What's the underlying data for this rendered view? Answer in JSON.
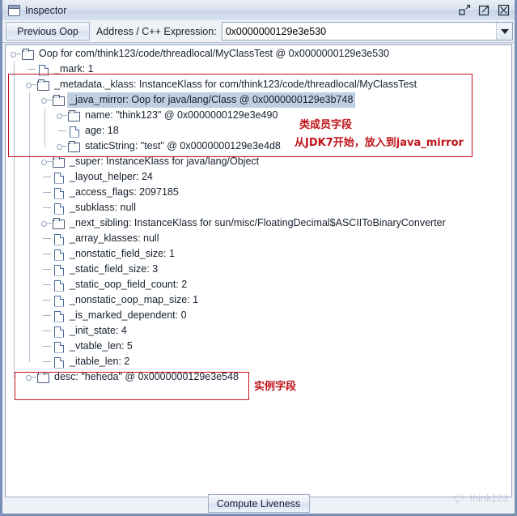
{
  "window": {
    "title": "Inspector",
    "icon": "window-icon",
    "buttons": [
      {
        "name": "minimize-button",
        "label": "Minimize"
      },
      {
        "name": "maximize-button",
        "label": "Maximize"
      },
      {
        "name": "close-button",
        "label": "Close"
      }
    ]
  },
  "toolbar": {
    "previous_oop_label": "Previous Oop",
    "address_label": "Address / C++ Expression:",
    "address_value": "0x0000000129e3e530",
    "address_placeholder": "",
    "dropdown_icon": "chevron-down-icon"
  },
  "tree": {
    "rows": [
      {
        "depth": 0,
        "icon": "folder",
        "handle": "expanded",
        "label": "Oop for com/think123/code/threadlocal/MyClassTest @ 0x0000000129e3e530",
        "selected": false
      },
      {
        "depth": 1,
        "icon": "doc",
        "handle": "leaf",
        "label": "_mark: 1",
        "selected": false
      },
      {
        "depth": 1,
        "icon": "folder",
        "handle": "expanded",
        "label": "_metadata._klass: InstanceKlass for com/think123/code/threadlocal/MyClassTest",
        "selected": false
      },
      {
        "depth": 2,
        "icon": "folder",
        "handle": "expanded",
        "label": "_java_mirror: Oop for java/lang/Class @ 0x0000000129e3b748",
        "selected": true
      },
      {
        "depth": 3,
        "icon": "folder",
        "handle": "collapsed",
        "label": "name: \"think123\" @ 0x0000000129e3e490",
        "selected": false
      },
      {
        "depth": 3,
        "icon": "doc",
        "handle": "leaf",
        "label": "age: 18",
        "selected": false
      },
      {
        "depth": 3,
        "icon": "folder",
        "handle": "collapsed",
        "label": "staticString: \"test\" @ 0x0000000129e3e4d8",
        "selected": false
      },
      {
        "depth": 2,
        "icon": "folder",
        "handle": "collapsed",
        "label": "_super: InstanceKlass for java/lang/Object",
        "selected": false
      },
      {
        "depth": 2,
        "icon": "doc",
        "handle": "leaf",
        "label": "_layout_helper: 24",
        "selected": false
      },
      {
        "depth": 2,
        "icon": "doc",
        "handle": "leaf",
        "label": "_access_flags: 2097185",
        "selected": false
      },
      {
        "depth": 2,
        "icon": "doc",
        "handle": "leaf",
        "label": "_subklass: null",
        "selected": false
      },
      {
        "depth": 2,
        "icon": "folder",
        "handle": "collapsed",
        "label": "_next_sibling: InstanceKlass for sun/misc/FloatingDecimal$ASCIIToBinaryConverter",
        "selected": false
      },
      {
        "depth": 2,
        "icon": "doc",
        "handle": "leaf",
        "label": "_array_klasses: null",
        "selected": false
      },
      {
        "depth": 2,
        "icon": "doc",
        "handle": "leaf",
        "label": "_nonstatic_field_size: 1",
        "selected": false
      },
      {
        "depth": 2,
        "icon": "doc",
        "handle": "leaf",
        "label": "_static_field_size: 3",
        "selected": false
      },
      {
        "depth": 2,
        "icon": "doc",
        "handle": "leaf",
        "label": "_static_oop_field_count: 2",
        "selected": false
      },
      {
        "depth": 2,
        "icon": "doc",
        "handle": "leaf",
        "label": "_nonstatic_oop_map_size: 1",
        "selected": false
      },
      {
        "depth": 2,
        "icon": "doc",
        "handle": "leaf",
        "label": "_is_marked_dependent: 0",
        "selected": false
      },
      {
        "depth": 2,
        "icon": "doc",
        "handle": "leaf",
        "label": "_init_state: 4",
        "selected": false
      },
      {
        "depth": 2,
        "icon": "doc",
        "handle": "leaf",
        "label": "_vtable_len: 5",
        "selected": false
      },
      {
        "depth": 2,
        "icon": "doc",
        "handle": "leaf",
        "label": "_itable_len: 2",
        "selected": false
      },
      {
        "depth": 1,
        "icon": "folder",
        "handle": "collapsed",
        "label": "desc: \"heheda\" @ 0x0000000129e3e548",
        "selected": false
      }
    ]
  },
  "annotations": {
    "color": "#c0141b",
    "class_member_fields": "类成员字段",
    "jdk7_note_prefix": "从",
    "jdk7_note_mono1": "JDK7",
    "jdk7_note_mid": "开始，放入到",
    "jdk7_note_mono2": "java_mirror",
    "instance_fields": "实例字段"
  },
  "footer": {
    "compute_liveness_label": "Compute Liveness",
    "watermark_label": "think123",
    "watermark_icon": "wechat-icon"
  }
}
